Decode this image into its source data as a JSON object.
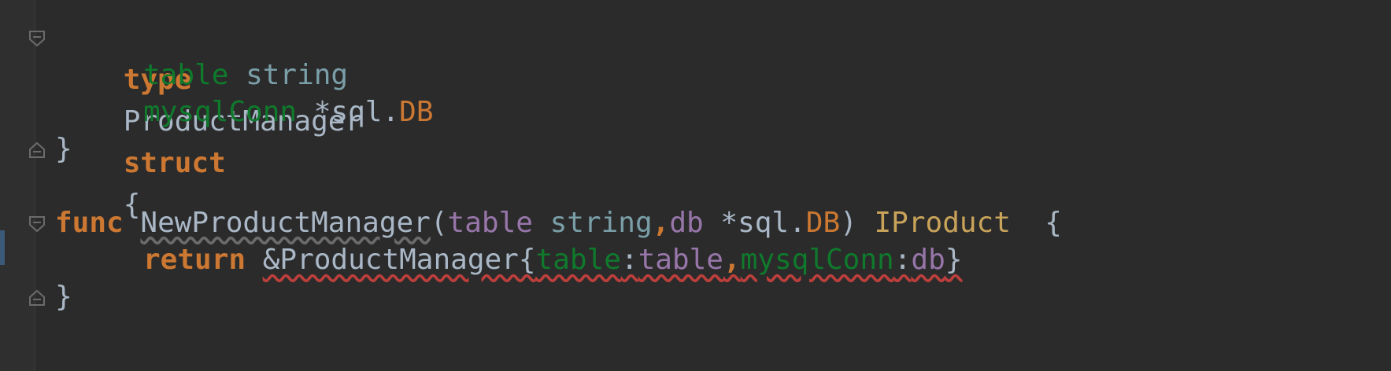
{
  "editor": {
    "lines": {
      "l1": {
        "kw_type": "type",
        "name": "ProductManager",
        "kw_struct": "struct",
        "brace": "{"
      },
      "l2": {
        "field": "table",
        "type": "string"
      },
      "l3": {
        "field": "mysqlConn",
        "star_pkg": "*sql.",
        "type": "DB"
      },
      "l4": {
        "brace": "}"
      },
      "l5": {
        "kw_func": "func",
        "fname": "NewProductManager",
        "open": "(",
        "p1": "table",
        "p1type": "string",
        "comma": ",",
        "p2": "db",
        "p2star": "*sql.",
        "p2type": "DB",
        "close": ")",
        "ret": "IProduct",
        "brace": "{"
      },
      "l6": {
        "kw_return": "return",
        "amp_type": "&ProductManager{",
        "f1": "table",
        "colon1": ":",
        "v1": "table",
        "comma": ",",
        "f2": "mysqlConn",
        "colon2": ":",
        "v2": "db",
        "close": "}"
      },
      "l7": {
        "brace": "}"
      }
    },
    "colors": {
      "background": "#2b2b2b",
      "keyword": "#cc7832",
      "field": "#0f7a2c",
      "parameter": "#9876aa",
      "builtin_type": "#7a9fa8",
      "interface": "#c9a35a",
      "error_underline": "#bc3f3c"
    },
    "icons": [
      "fold-open-icon",
      "fold-close-icon"
    ]
  }
}
